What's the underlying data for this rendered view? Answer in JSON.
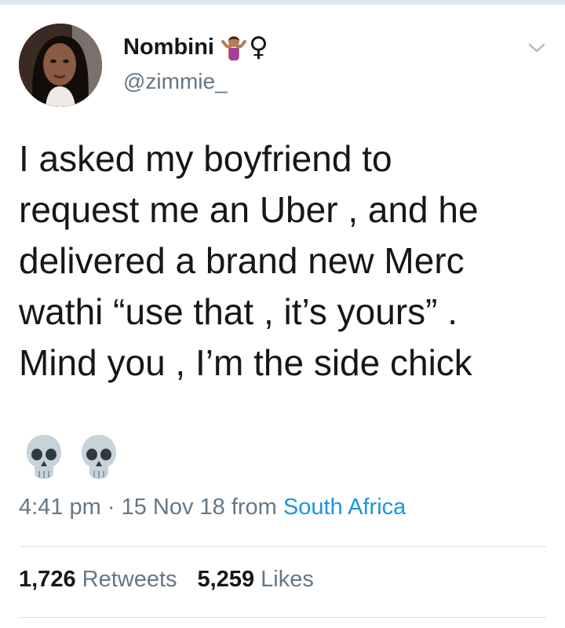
{
  "user": {
    "display_name": "Nombini",
    "emoji_name": "person-shrugging-icon",
    "gender_sign": "♀",
    "handle": "@zimmie_"
  },
  "tweet": {
    "lines": [
      "I asked my boyfriend to",
      "request me an Uber , and he",
      "delivered a brand new Merc",
      "wathi “use that , it’s yours” .",
      "Mind you , I’m the side chick"
    ],
    "emojis": [
      "skull-icon",
      "skull-icon"
    ]
  },
  "meta": {
    "time": "4:41 pm",
    "separator": " · ",
    "date": "15 Nov 18",
    "from_label": " from ",
    "location": "South Africa"
  },
  "stats": {
    "retweets_count": "1,726",
    "retweets_label": "Retweets",
    "likes_count": "5,259",
    "likes_label": "Likes"
  },
  "colors": {
    "text": "#14171a",
    "secondary": "#657786",
    "link": "#1b95e0",
    "divider": "#d9dfe4"
  }
}
